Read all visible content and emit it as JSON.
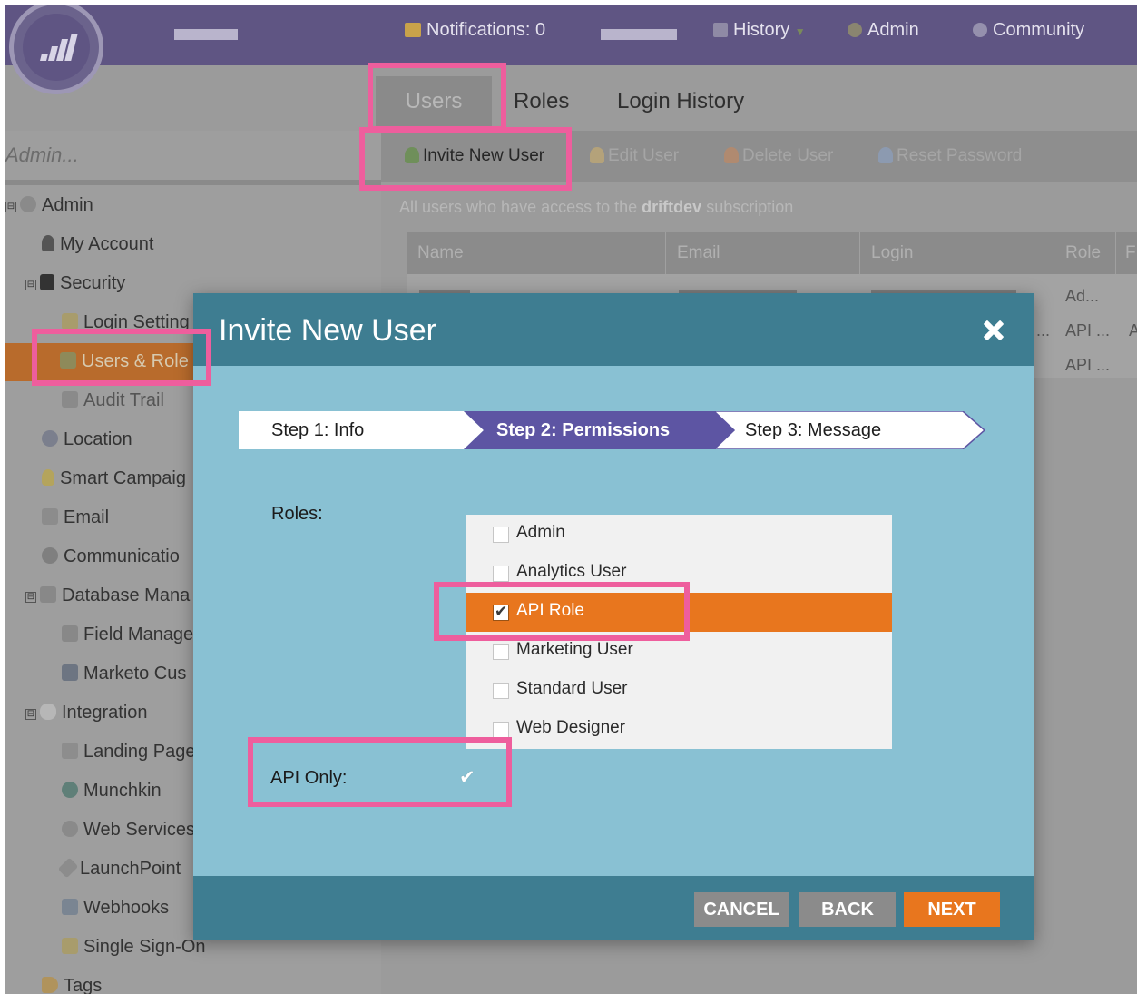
{
  "colors": {
    "accent_orange": "#e8761e",
    "modal_header": "#3e7d91",
    "modal_body": "#89c1d3",
    "step_active": "#5d55a3",
    "highlight_pink": "#ee5e9d"
  },
  "header": {
    "notifications": "Notifications: 0",
    "history": "History",
    "admin": "Admin",
    "community": "Community"
  },
  "tabs": [
    "Users",
    "Roles",
    "Login History"
  ],
  "toolbar": {
    "invite": "Invite New User",
    "edit": "Edit User",
    "delete": "Delete User",
    "reset": "Reset Password"
  },
  "subtitle": {
    "prefix": "All users who have access to the",
    "subscription": "driftdev",
    "suffix": "subscription"
  },
  "grid": {
    "columns": [
      "Name",
      "Email",
      "Login",
      "Role",
      "F"
    ],
    "roles": [
      "Ad...",
      "API ...",
      "API ..."
    ],
    "extra": "A",
    "ellipsis": "..."
  },
  "sidebar": {
    "search": "Admin...",
    "items": [
      {
        "label": "Admin",
        "icon": "gear-icon"
      },
      {
        "label": "My Account",
        "icon": "person-icon"
      },
      {
        "label": "Security",
        "icon": "lock-icon"
      },
      {
        "label": "Login Setting",
        "icon": "key-icon"
      },
      {
        "label": "Users & Role",
        "icon": "users-icon"
      },
      {
        "label": "Audit Trail",
        "icon": "audit-icon"
      },
      {
        "label": "Location",
        "icon": "globe-icon"
      },
      {
        "label": "Smart Campaig",
        "icon": "lightbulb-icon"
      },
      {
        "label": "Email",
        "icon": "email-icon"
      },
      {
        "label": "Communicatio",
        "icon": "at-icon"
      },
      {
        "label": "Database Mana",
        "icon": "database-icon"
      },
      {
        "label": "Field Manage",
        "icon": "field-icon"
      },
      {
        "label": "Marketo Cus",
        "icon": "custom-icon"
      },
      {
        "label": "Integration",
        "icon": "cloud-icon"
      },
      {
        "label": "Landing Page",
        "icon": "page-icon"
      },
      {
        "label": "Munchkin",
        "icon": "munchkin-icon"
      },
      {
        "label": "Web Services",
        "icon": "webservices-icon"
      },
      {
        "label": "LaunchPoint",
        "icon": "rocket-icon"
      },
      {
        "label": "Webhooks",
        "icon": "webhooks-icon"
      },
      {
        "label": "Single Sign-On",
        "icon": "key-icon"
      },
      {
        "label": "Tags",
        "icon": "tag-icon"
      }
    ]
  },
  "modal": {
    "title": "Invite New User",
    "steps": [
      "Step 1: Info",
      "Step 2: Permissions",
      "Step 3: Message"
    ],
    "active_step": "Step 2: Permissions",
    "roles_label": "Roles:",
    "roles": [
      {
        "label": "Admin",
        "checked": false
      },
      {
        "label": "Analytics User",
        "checked": false
      },
      {
        "label": "API Role",
        "checked": true
      },
      {
        "label": "Marketing User",
        "checked": false
      },
      {
        "label": "Standard User",
        "checked": false
      },
      {
        "label": "Web Designer",
        "checked": false
      }
    ],
    "api_only_label": "API Only:",
    "api_only": true,
    "buttons": {
      "cancel": "CANCEL",
      "back": "BACK",
      "next": "NEXT"
    }
  }
}
